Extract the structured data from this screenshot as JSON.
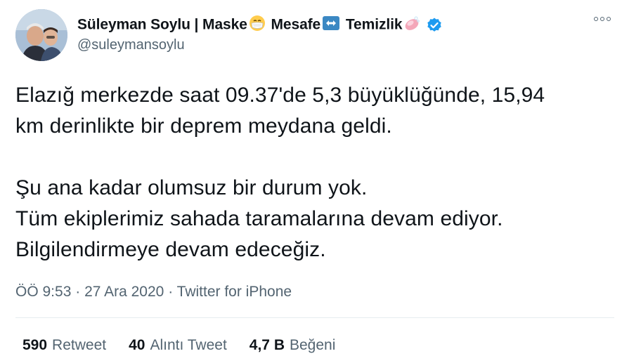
{
  "author": {
    "name_parts": [
      "Süleyman Soylu | Maske",
      "Mesafe",
      "Temizlik"
    ],
    "handle": "@suleymansoylu",
    "verified": true,
    "name_emojis": [
      "mask-face-emoji",
      "left-right-arrow-emoji",
      "soap-emoji"
    ],
    "verified_color": "#1d9bf0"
  },
  "tweet": {
    "paragraphs": [
      [
        "Elazığ merkezde saat 09.37'de 5,3 büyüklüğünde, 15,94",
        "km derinlikte bir deprem meydana geldi."
      ],
      [
        "Şu ana kadar olumsuz bir durum yok.",
        "Tüm ekiplerimiz sahada taramalarına devam ediyor.",
        "Bilgilendirmeye devam edeceğiz."
      ]
    ]
  },
  "meta": {
    "time": "ÖÖ 9:53",
    "separator": "·",
    "date": "27 Ara 2020",
    "source": "Twitter for iPhone"
  },
  "stats": {
    "retweets": {
      "count": "590",
      "label": "Retweet"
    },
    "quotes": {
      "count": "40",
      "label": "Alıntı Tweet"
    },
    "likes": {
      "count": "4,7 B",
      "label": "Beğeni"
    }
  },
  "more_icon": "more-dots-icon"
}
